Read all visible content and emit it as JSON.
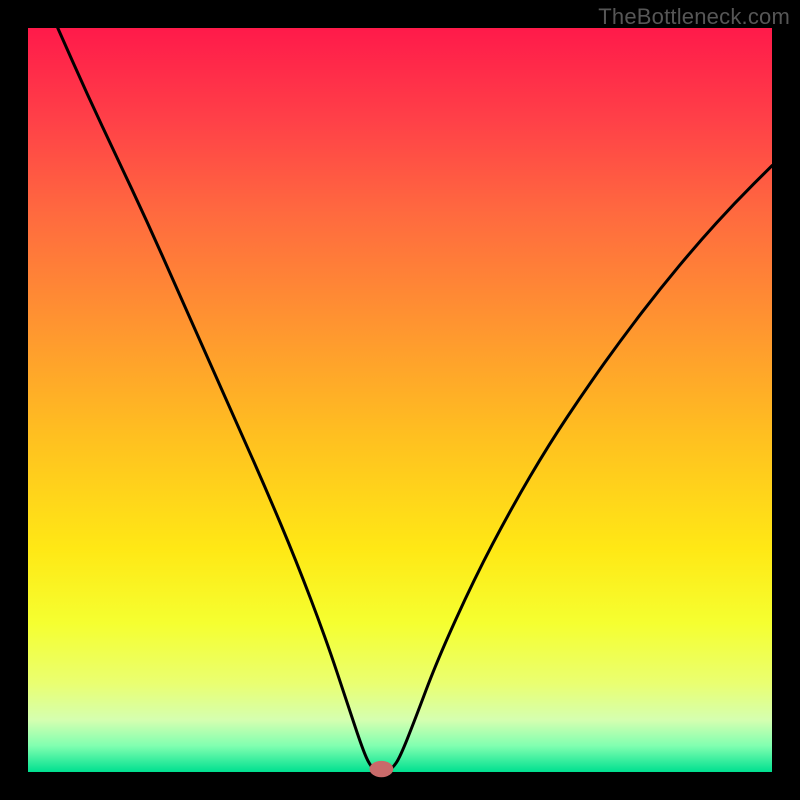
{
  "watermark": "TheBottleneck.com",
  "chart_data": {
    "type": "line",
    "title": "",
    "xlabel": "",
    "ylabel": "",
    "xlim": [
      0,
      100
    ],
    "ylim": [
      0,
      100
    ],
    "background_gradient": {
      "stops": [
        {
          "offset": 0.0,
          "color": "#ff1a4a"
        },
        {
          "offset": 0.12,
          "color": "#ff3f48"
        },
        {
          "offset": 0.25,
          "color": "#ff6a3f"
        },
        {
          "offset": 0.4,
          "color": "#ff9530"
        },
        {
          "offset": 0.55,
          "color": "#ffc020"
        },
        {
          "offset": 0.7,
          "color": "#ffe815"
        },
        {
          "offset": 0.8,
          "color": "#f5ff30"
        },
        {
          "offset": 0.88,
          "color": "#eaff70"
        },
        {
          "offset": 0.93,
          "color": "#d5ffb0"
        },
        {
          "offset": 0.965,
          "color": "#80ffb0"
        },
        {
          "offset": 1.0,
          "color": "#00e090"
        }
      ]
    },
    "frame": {
      "outer": 800,
      "inner_left": 28,
      "inner_top": 28,
      "inner_right": 772,
      "inner_bottom": 772
    },
    "curve": {
      "description": "V-shaped bottleneck curve with minimum near x≈47",
      "min_x": 47,
      "points": [
        {
          "x": 4.0,
          "y": 100.0
        },
        {
          "x": 8.0,
          "y": 91.0
        },
        {
          "x": 12.0,
          "y": 82.5
        },
        {
          "x": 16.0,
          "y": 74.0
        },
        {
          "x": 20.0,
          "y": 65.0
        },
        {
          "x": 24.0,
          "y": 56.0
        },
        {
          "x": 28.0,
          "y": 47.0
        },
        {
          "x": 32.0,
          "y": 38.0
        },
        {
          "x": 36.0,
          "y": 28.5
        },
        {
          "x": 40.0,
          "y": 18.0
        },
        {
          "x": 43.0,
          "y": 9.0
        },
        {
          "x": 45.0,
          "y": 3.0
        },
        {
          "x": 46.0,
          "y": 0.8
        },
        {
          "x": 47.0,
          "y": 0.0
        },
        {
          "x": 48.0,
          "y": 0.0
        },
        {
          "x": 49.0,
          "y": 0.5
        },
        {
          "x": 50.0,
          "y": 2.0
        },
        {
          "x": 52.0,
          "y": 7.0
        },
        {
          "x": 55.0,
          "y": 15.0
        },
        {
          "x": 60.0,
          "y": 26.0
        },
        {
          "x": 65.0,
          "y": 35.5
        },
        {
          "x": 70.0,
          "y": 44.0
        },
        {
          "x": 75.0,
          "y": 51.5
        },
        {
          "x": 80.0,
          "y": 58.5
        },
        {
          "x": 85.0,
          "y": 65.0
        },
        {
          "x": 90.0,
          "y": 71.0
        },
        {
          "x": 95.0,
          "y": 76.5
        },
        {
          "x": 100.0,
          "y": 81.5
        }
      ]
    },
    "marker": {
      "x": 47.5,
      "y": 0.4,
      "rx": 1.6,
      "ry": 1.1,
      "color": "#c96a6a"
    }
  }
}
